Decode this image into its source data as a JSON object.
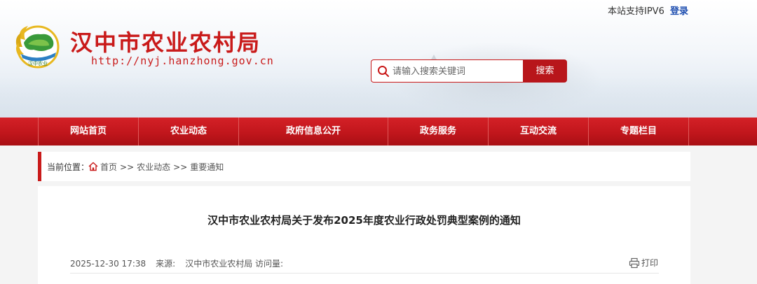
{
  "header": {
    "ipv6_text": "本站支持IPV6",
    "login_label": "登录",
    "site_title": "汉中市农业农村局",
    "site_url": "http://nyj.hanzhong.gov.cn",
    "logo_text": "汉中农业",
    "search": {
      "placeholder": "请输入搜索关键词",
      "button_label": "搜索"
    }
  },
  "nav": {
    "items": [
      {
        "label": "网站首页"
      },
      {
        "label": "农业动态"
      },
      {
        "label": "政府信息公开"
      },
      {
        "label": "政务服务"
      },
      {
        "label": "互动交流"
      },
      {
        "label": "专题栏目"
      }
    ]
  },
  "breadcrumb": {
    "label": "当前位置：",
    "items": [
      "首页",
      "农业动态",
      "重要通知"
    ],
    "separator": ">>"
  },
  "article": {
    "title": "汉中市农业农村局关于发布2025年度农业行政处罚典型案例的通知",
    "date": "2025-12-30 17:38",
    "source_label": "来源:",
    "source": "汉中市农业农村局",
    "visits_label": "访问量:",
    "print_label": "打印"
  },
  "colors": {
    "brand_red": "#c91a1a",
    "nav_red": "#c1161c",
    "login_blue": "#1f4fb0"
  }
}
